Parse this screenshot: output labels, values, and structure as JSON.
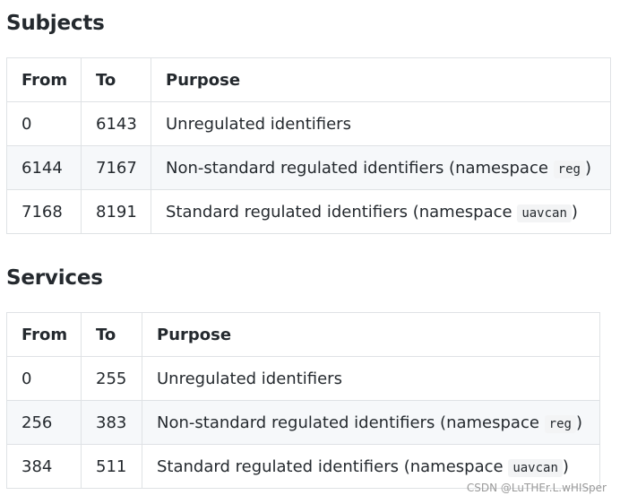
{
  "subjects": {
    "title": "Subjects",
    "headers": [
      "From",
      "To",
      "Purpose"
    ],
    "rows": [
      {
        "from": "0",
        "to": "6143",
        "purpose": "Unregulated identifiers",
        "namespace": null
      },
      {
        "from": "6144",
        "to": "7167",
        "purpose": "Non-standard regulated identifiers (namespace ",
        "namespace": "reg",
        "suffix": ")"
      },
      {
        "from": "7168",
        "to": "8191",
        "purpose": "Standard regulated identifiers (namespace ",
        "namespace": "uavcan",
        "suffix": ")"
      }
    ]
  },
  "services": {
    "title": "Services",
    "headers": [
      "From",
      "To",
      "Purpose"
    ],
    "rows": [
      {
        "from": "0",
        "to": "255",
        "purpose": "Unregulated identifiers",
        "namespace": null
      },
      {
        "from": "256",
        "to": "383",
        "purpose": "Non-standard regulated identifiers (namespace ",
        "namespace": "reg",
        "suffix": ")"
      },
      {
        "from": "384",
        "to": "511",
        "purpose": "Standard regulated identifiers (namespace ",
        "namespace": "uavcan",
        "suffix": ")"
      }
    ]
  },
  "watermark": "CSDN @LuTHEr.L.wHISper"
}
